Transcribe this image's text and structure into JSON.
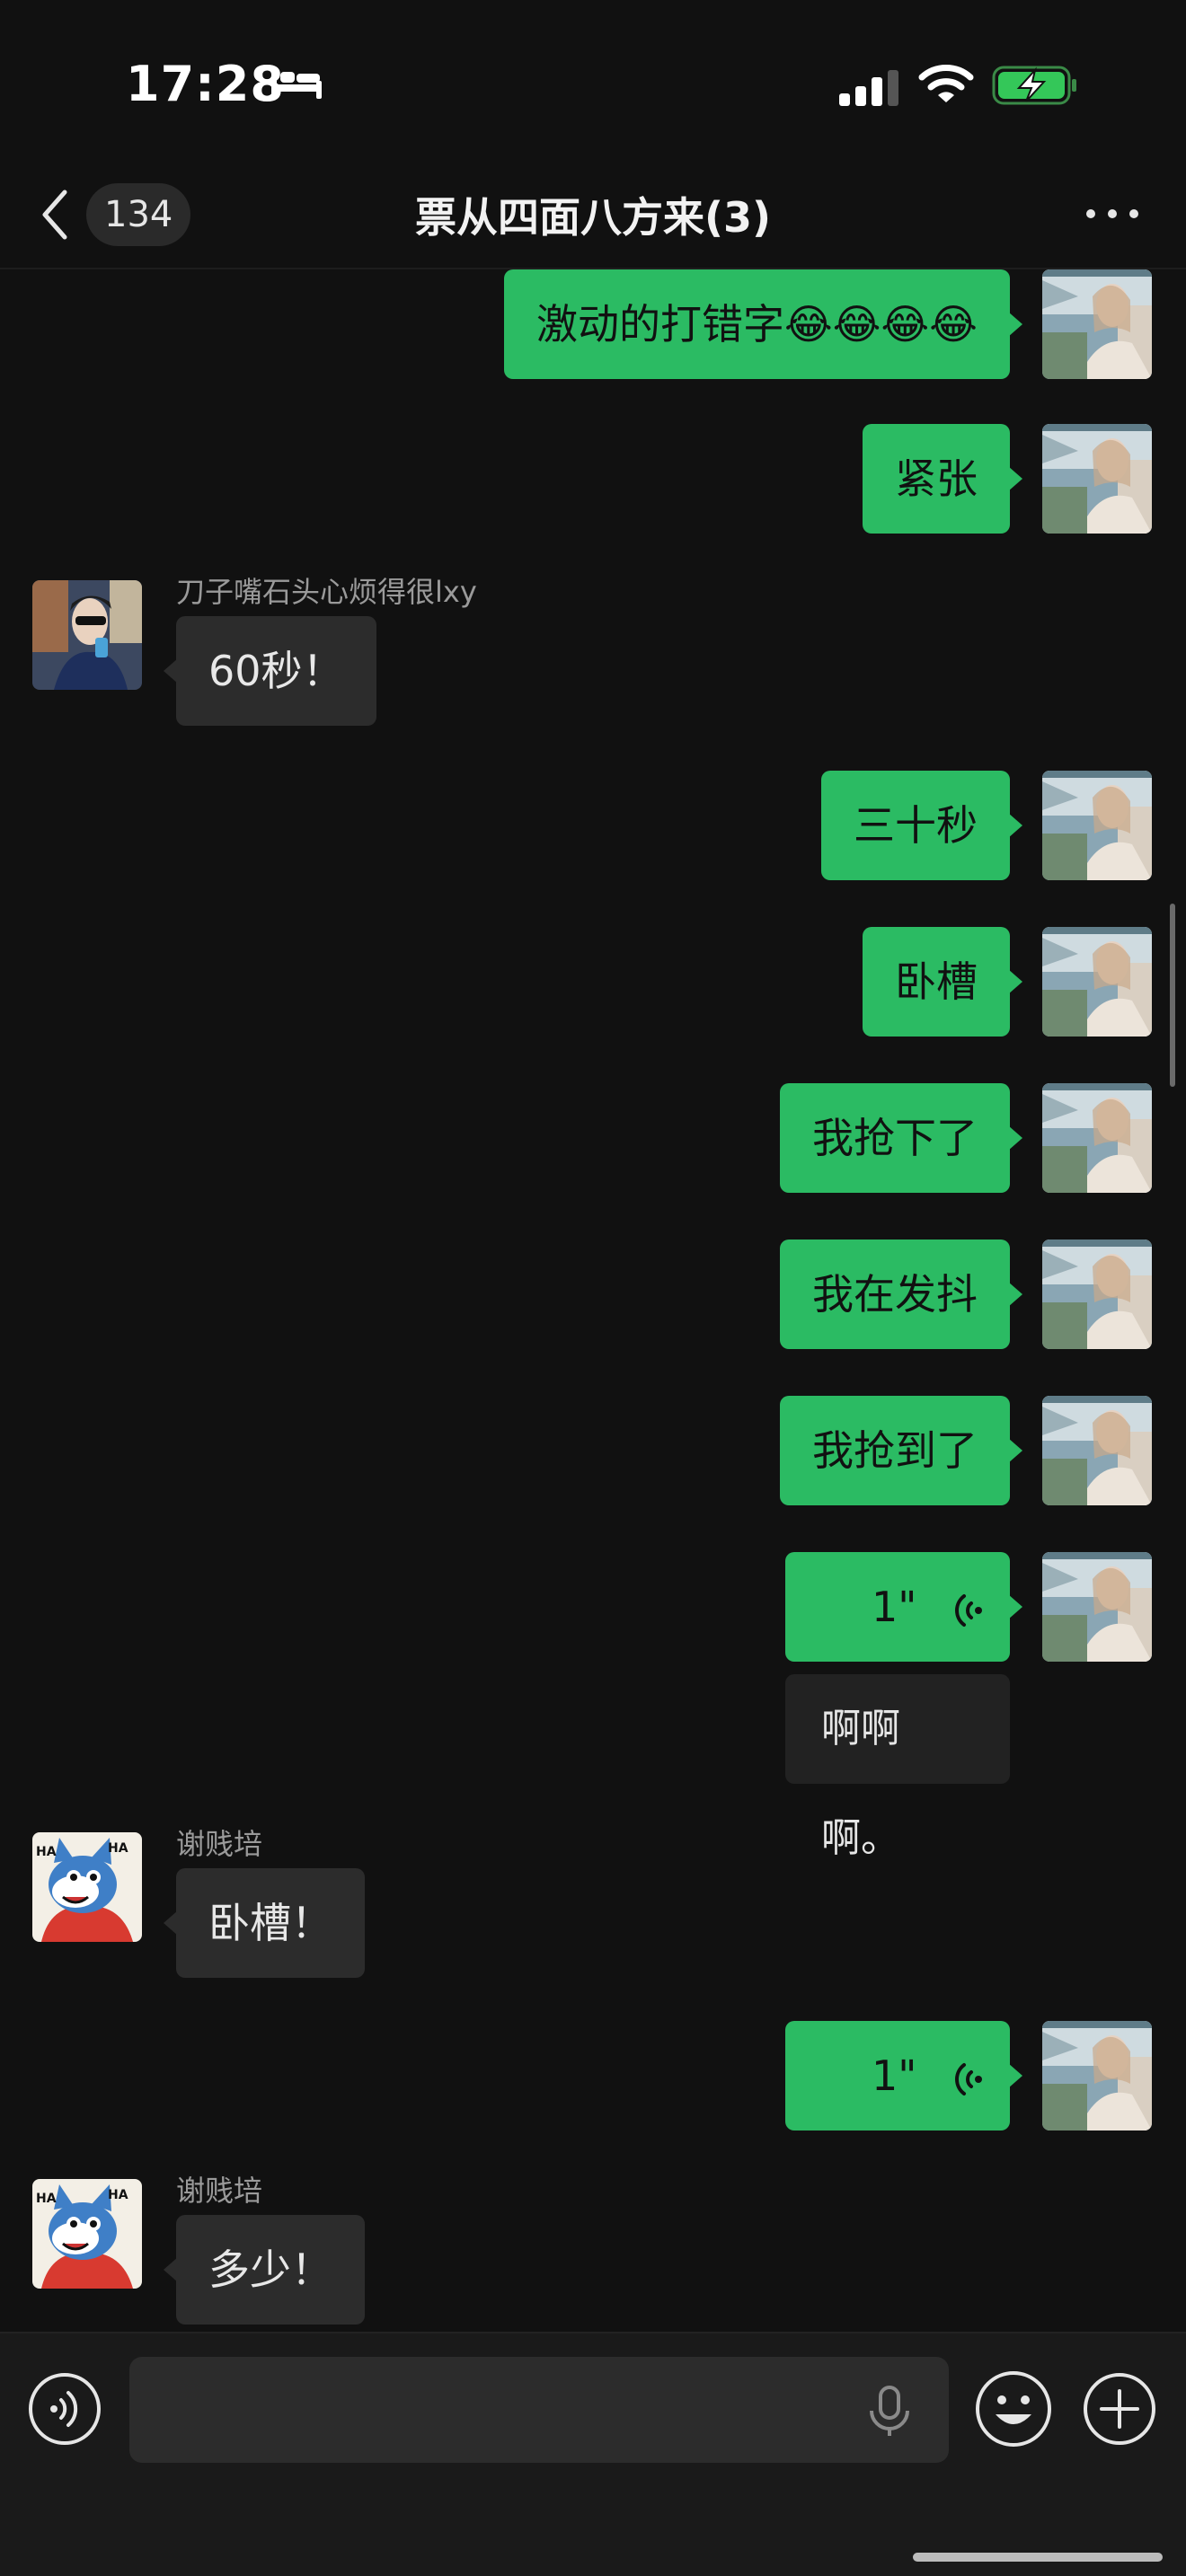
{
  "status_bar": {
    "time": "17:28"
  },
  "nav": {
    "unread_count": "134",
    "title": "票从四面八方来(3)"
  },
  "messages": [
    {
      "direction": "out",
      "text": "激动的打错字😂😂😂😂"
    },
    {
      "direction": "out",
      "text": "紧张"
    },
    {
      "direction": "in",
      "sender": "刀子嘴石头心烦得很lxy",
      "text": "60秒！"
    },
    {
      "direction": "out",
      "text": "三十秒"
    },
    {
      "direction": "out",
      "text": "卧槽"
    },
    {
      "direction": "out",
      "text": "我抢下了"
    },
    {
      "direction": "out",
      "text": "我在发抖"
    },
    {
      "direction": "out",
      "text": "我抢到了"
    },
    {
      "direction": "out",
      "type": "voice",
      "duration": "1\"",
      "transcript": "啊啊啊。"
    },
    {
      "direction": "in",
      "sender": "谢贱培",
      "text": "卧槽！"
    },
    {
      "direction": "out",
      "type": "voice",
      "duration": "1\""
    },
    {
      "direction": "in",
      "sender": "谢贱培",
      "text": "多少！"
    }
  ],
  "input": {
    "value": ""
  },
  "colors": {
    "outgoing_bubble": "#2bbb63",
    "incoming_bubble": "#2c2c2c",
    "background": "#111111"
  }
}
